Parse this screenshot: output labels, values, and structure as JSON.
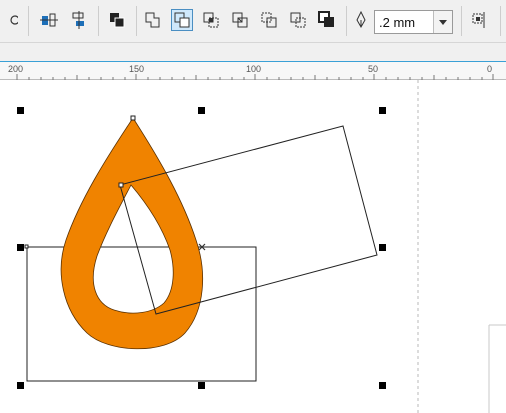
{
  "toolbar": {
    "outline_width": ".2 mm",
    "buttons": [
      {
        "name": "ellipse-tool-icon"
      },
      {
        "name": "align-icon"
      },
      {
        "name": "distribute-icon"
      },
      {
        "name": "to-back-icon"
      },
      {
        "name": "weld-icon"
      },
      {
        "name": "trim-icon"
      },
      {
        "name": "intersect-icon"
      },
      {
        "name": "simplify-icon"
      },
      {
        "name": "front-minus-back-icon"
      },
      {
        "name": "back-minus-front-icon"
      },
      {
        "name": "boundary-icon"
      },
      {
        "name": "pen-nib-icon"
      },
      {
        "name": "align-distribute-icon"
      }
    ]
  },
  "ruler": {
    "labels": [
      "200",
      "150",
      "100",
      "50",
      "0"
    ]
  },
  "colors": {
    "fill": "#f08300",
    "ruler_accent": "#3aa0d6",
    "active_button_bg": "#cfe8fb"
  }
}
